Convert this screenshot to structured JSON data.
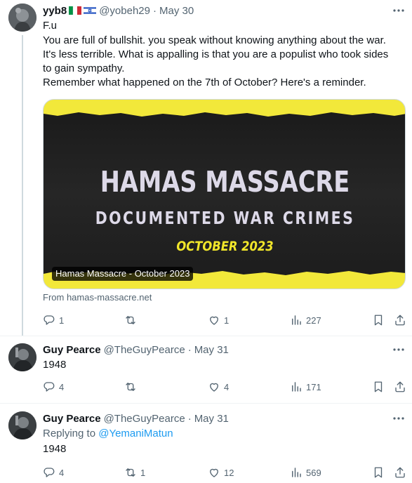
{
  "tweets": [
    {
      "name": "yyb8",
      "handle": "@yobeh29",
      "date": "May 30",
      "lines": [
        "F.u",
        "You are full of bullshit. you speak without knowing anything about the war.",
        "It's less terrible.  What is appalling is that you are a populist who took sides",
        "to gain sympathy.",
        "Remember what happened on the 7th of October? Here's a reminder."
      ],
      "card": {
        "headline_1": "HAMAS MASSACRE",
        "headline_2": "DOCUMENTED WAR CRIMES",
        "headline_3": "OCTOBER 2023",
        "caption": "Hamas Massacre - October 2023",
        "source": "From hamas-massacre.net"
      },
      "stats": {
        "replies": "1",
        "reposts": "",
        "likes": "1",
        "views": "227"
      }
    },
    {
      "name": "Guy Pearce",
      "handle": "@TheGuyPearce",
      "date": "May 31",
      "lines": [
        "1948"
      ],
      "stats": {
        "replies": "4",
        "reposts": "",
        "likes": "4",
        "views": "171"
      }
    },
    {
      "name": "Guy Pearce",
      "handle": "@TheGuyPearce",
      "date": "May 31",
      "replying_prefix": "Replying to ",
      "replying_to": "@YemaniMatun",
      "lines": [
        "1948"
      ],
      "stats": {
        "replies": "4",
        "reposts": "1",
        "likes": "12",
        "views": "569"
      }
    }
  ],
  "icons": {
    "reply": "reply-icon",
    "repost": "repost-icon",
    "like": "heart-icon",
    "views": "views-icon",
    "bookmark": "bookmark-icon",
    "share": "share-icon",
    "more": "more-icon"
  },
  "colors": {
    "text": "#0f1419",
    "muted": "#536471",
    "link": "#1d9bf0",
    "card_yellow": "#f2e83a",
    "card_dark": "#1b1b1b"
  }
}
